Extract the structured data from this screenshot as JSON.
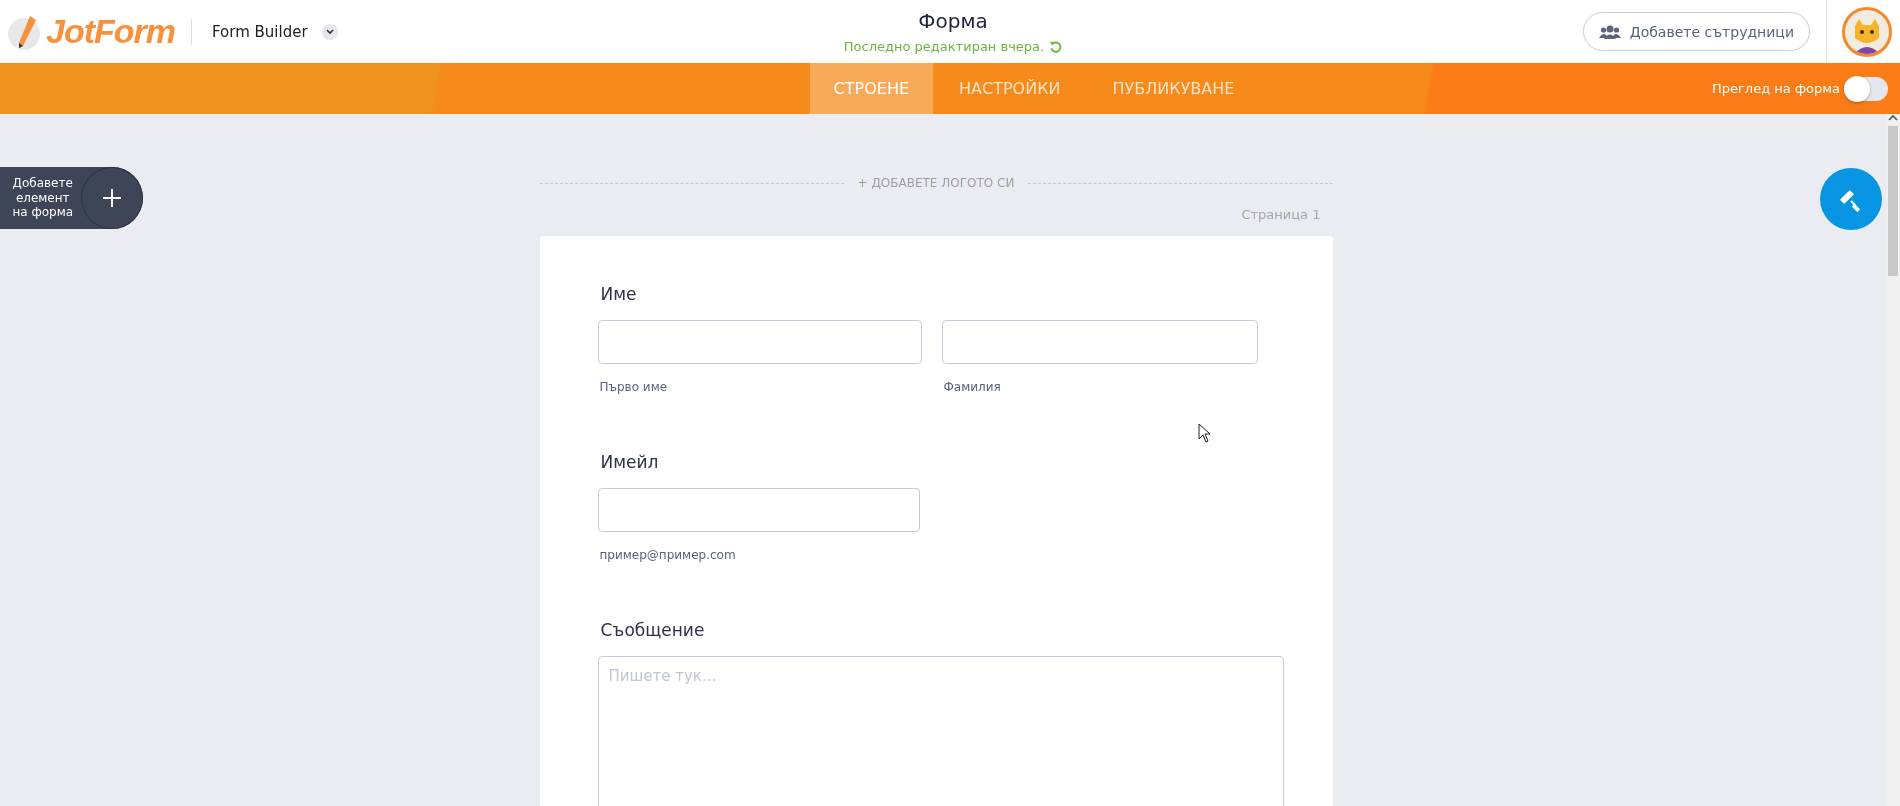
{
  "header": {
    "logo": "JotForm",
    "app_name": "Form Builder",
    "title": "Форма",
    "last_edited": "Последно редактиран вчера.",
    "collaborators_button": "Добавете сътрудници"
  },
  "tabs": [
    {
      "label": "СТРОЕНЕ",
      "selected": true
    },
    {
      "label": "НАСТРОЙКИ",
      "selected": false
    },
    {
      "label": "ПУБЛИКУВАНЕ",
      "selected": false
    }
  ],
  "preview_toggle": {
    "label": "Преглед на форма",
    "on": false
  },
  "add_element_button": "Добавете елемент на форма",
  "add_logo": "+ ДОБАВЕТЕ ЛОГОТО СИ",
  "page_label": "Страница 1",
  "fields": [
    {
      "kind": "name",
      "label": "Име",
      "inputs": [
        {
          "sublabel": "Първо име"
        },
        {
          "sublabel": "Фамилия"
        }
      ]
    },
    {
      "kind": "email",
      "label": "Имейл",
      "inputs": [
        {
          "sublabel": "пример@пример.com"
        }
      ]
    },
    {
      "kind": "textarea",
      "label": "Съобщение",
      "placeholder": "Пишете тук..."
    }
  ]
}
